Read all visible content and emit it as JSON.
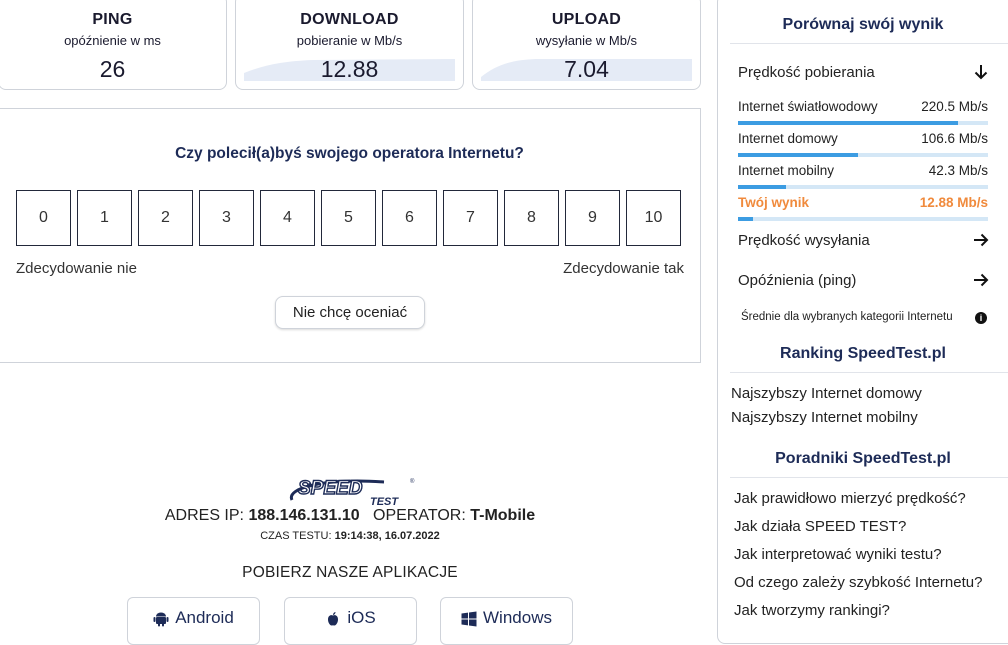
{
  "results": {
    "ping": {
      "title": "PING",
      "subtitle": "opóźnienie w ms",
      "value": "26"
    },
    "download": {
      "title": "DOWNLOAD",
      "subtitle": "pobieranie w Mb/s",
      "value": "12.88"
    },
    "upload": {
      "title": "UPLOAD",
      "subtitle": "wysyłanie w Mb/s",
      "value": "7.04"
    }
  },
  "survey": {
    "question": "Czy polecił(a)byś swojego operatora Internetu?",
    "scale": [
      "0",
      "1",
      "2",
      "3",
      "4",
      "5",
      "6",
      "7",
      "8",
      "9",
      "10"
    ],
    "left_label": "Zdecydowanie nie",
    "right_label": "Zdecydowanie tak",
    "skip_label": "Nie chcę oceniać"
  },
  "footer": {
    "logo_top": "SPEED",
    "logo_bottom": "TEST",
    "ip_label": "ADRES IP:",
    "ip_value": "188.146.131.10",
    "operator_label": "OPERATOR:",
    "operator_value": "T-Mobile",
    "time_label": "CZAS TESTU:",
    "time_value": "19:14:38, 16.07.2022",
    "apps_heading": "POBIERZ NASZE APLIKACJE",
    "apps": [
      {
        "label": "Android",
        "icon": "android-icon"
      },
      {
        "label": "iOS",
        "icon": "apple-icon"
      },
      {
        "label": "Windows",
        "icon": "windows-icon"
      }
    ]
  },
  "sidebar": {
    "compare_heading": "Porównaj swój wynik",
    "download_speed": "Prędkość pobierania",
    "comparisons": [
      {
        "name": "Internet światłowodowy",
        "value": "220.5 Mb/s",
        "fraction": 0.88
      },
      {
        "name": "Internet domowy",
        "value": "106.6 Mb/s",
        "fraction": 0.48
      },
      {
        "name": "Internet mobilny",
        "value": "42.3 Mb/s",
        "fraction": 0.19
      },
      {
        "name": "Twój wynik",
        "value": "12.88 Mb/s",
        "fraction": 0.06
      }
    ],
    "upload_speed": "Prędkość wysyłania",
    "latency": "Opóźnienia (ping)",
    "note": "Średnie dla wybranych kategorii Internetu",
    "ranking_heading": "Ranking SpeedTest.pl",
    "ranking_links": [
      "Najszybszy Internet domowy",
      "Najszybszy Internet mobilny"
    ],
    "guides_heading": "Poradniki SpeedTest.pl",
    "guides_links": [
      "Jak prawidłowo mierzyć prędkość?",
      "Jak działa SPEED TEST?",
      "Jak interpretować wyniki testu?",
      "Od czego zależy szybkość Internetu?",
      "Jak tworzymy rankingi?"
    ],
    "colors": {
      "accent": "#3c9ce2",
      "highlight": "#f08a3c",
      "heading": "#1d2b57"
    }
  }
}
